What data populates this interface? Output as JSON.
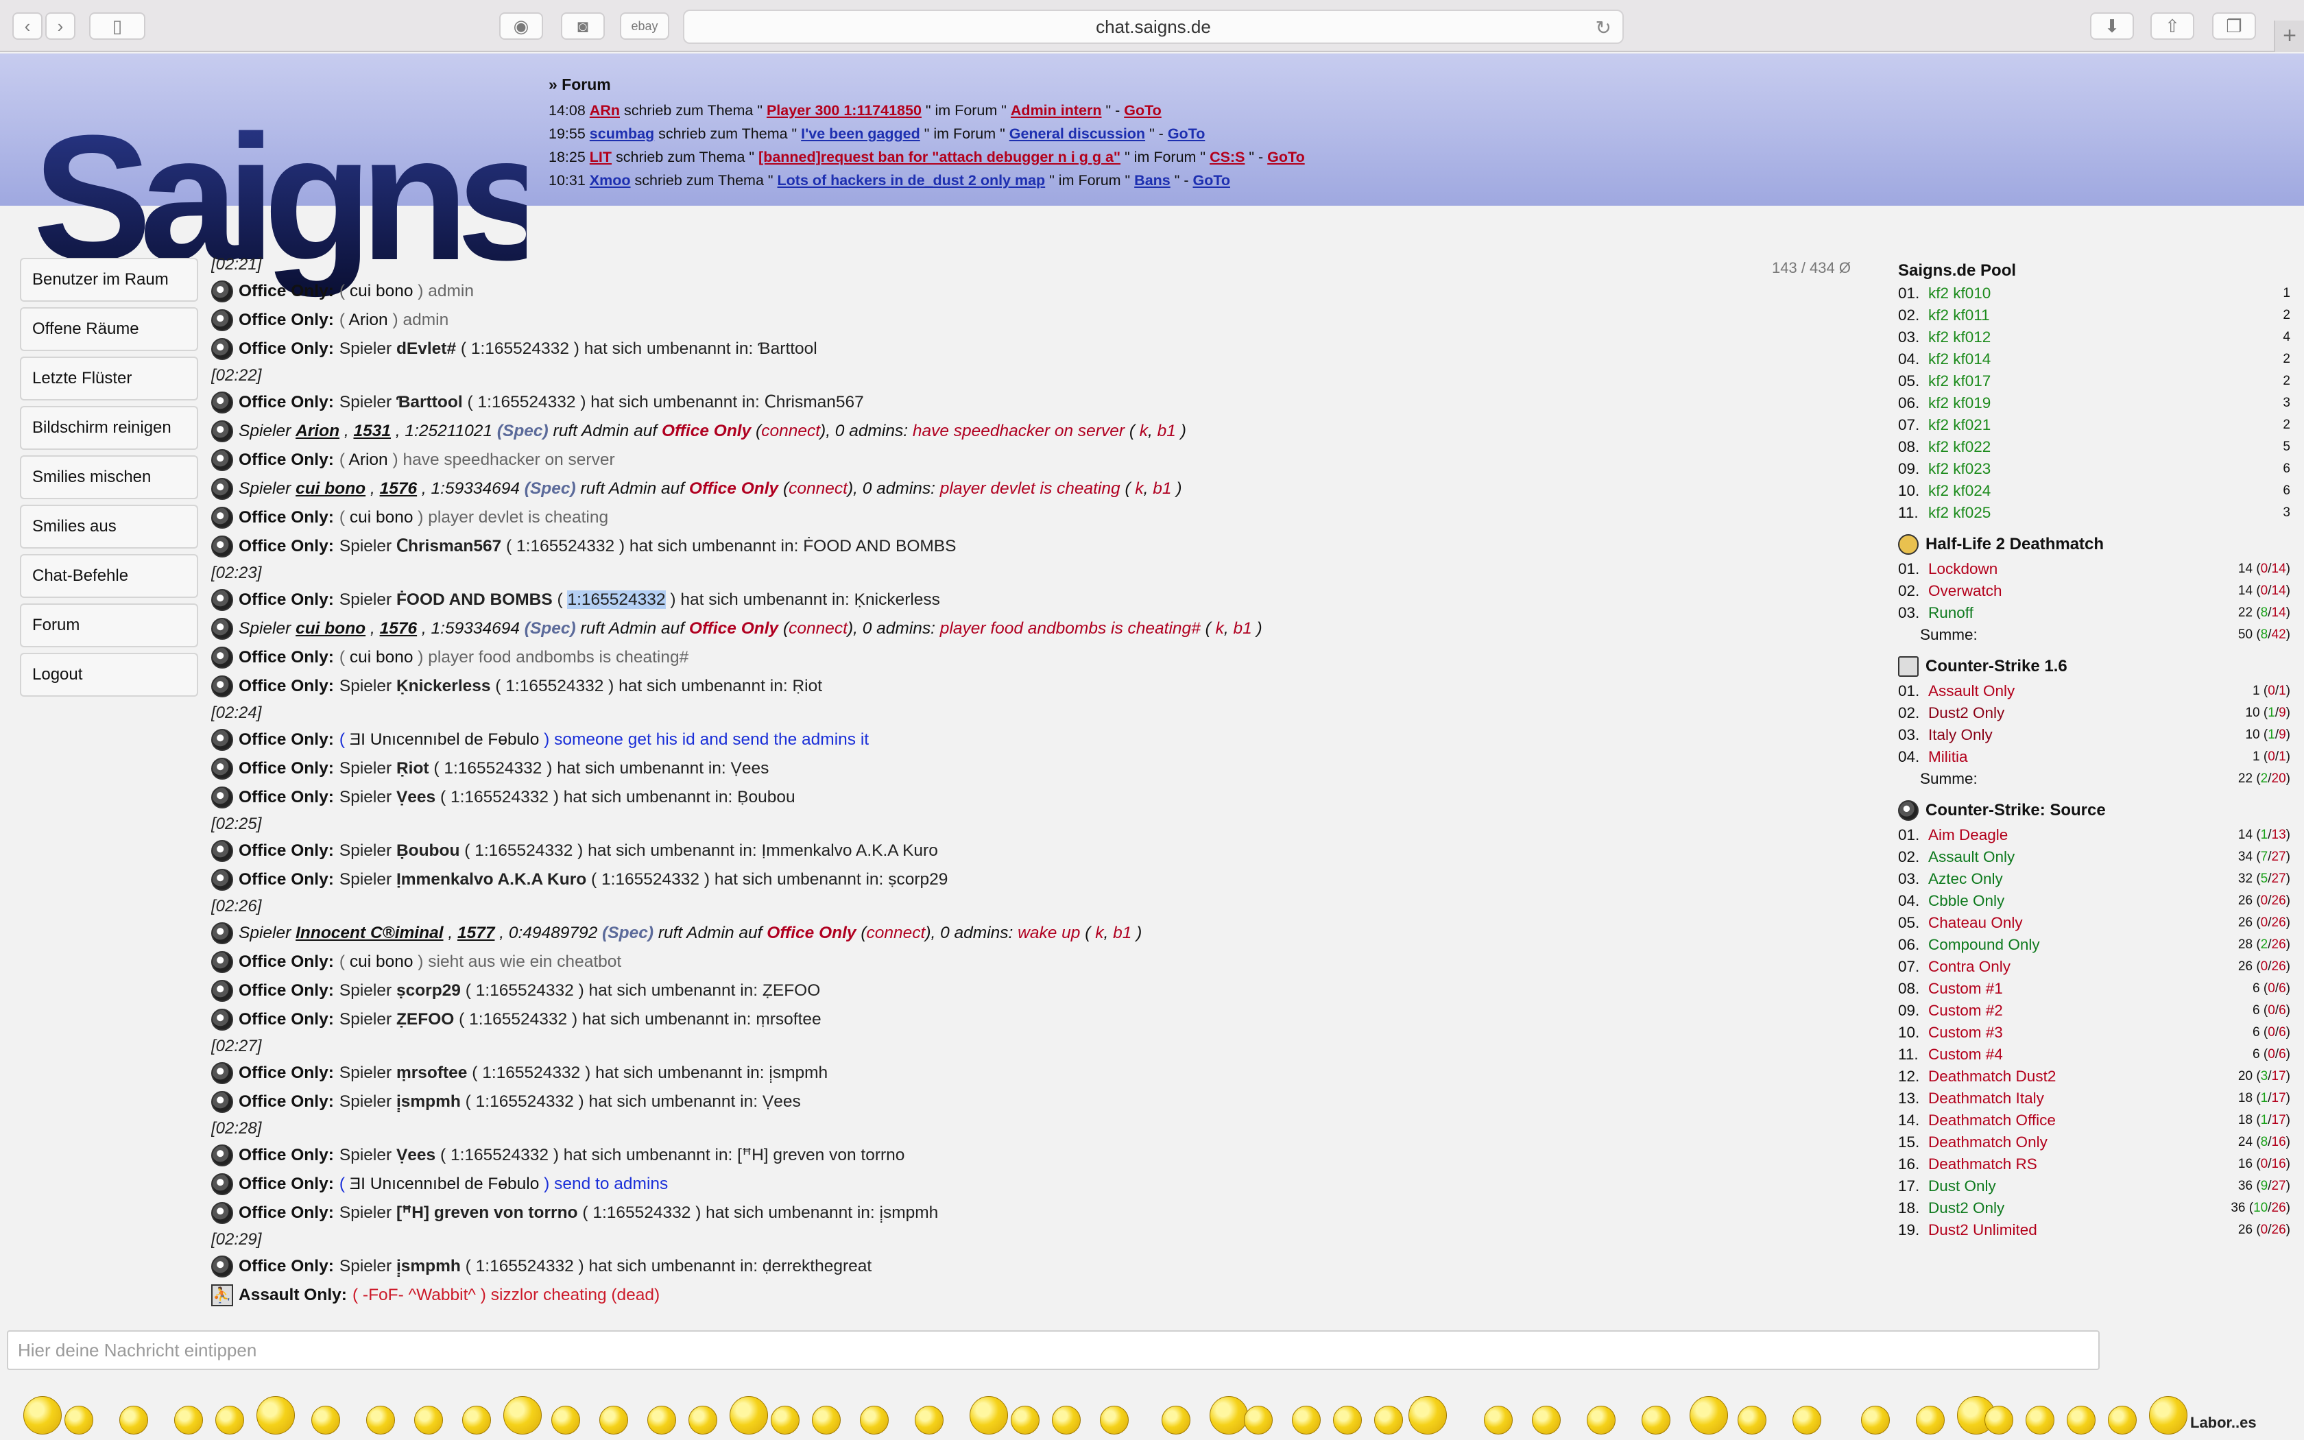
{
  "browser": {
    "url": "chat.saigns.de",
    "bookmark_ebay": "ebay"
  },
  "logo": {
    "text": "Saigns"
  },
  "news": {
    "title": "» Forum",
    "entries": [
      {
        "time": "14:08",
        "user": "ARn",
        "mid": "schrieb zum Thema \"",
        "topic": "Player 300 1:11741850",
        "mid2": "\" im Forum \"",
        "forum": "Admin intern",
        "end": "\" -",
        "goto": "GoTo",
        "color": "red"
      },
      {
        "time": "19:55",
        "user": "scumbag",
        "mid": "schrieb zum Thema \"",
        "topic": "I've been gagged",
        "mid2": "\" im Forum \"",
        "forum": "General discussion",
        "end": "\" -",
        "goto": "GoTo",
        "color": "blue"
      },
      {
        "time": "18:25",
        "user": "LIT",
        "mid": "schrieb zum Thema \"",
        "topic": "[banned]request ban for \"attach debugger n i g g a\"",
        "mid2": "\" im Forum \"",
        "forum": "CS:S",
        "end": "\" -",
        "goto": "GoTo",
        "color": "red"
      },
      {
        "time": "10:31",
        "user": "Xmoo",
        "mid": "schrieb zum Thema \"",
        "topic": "Lots of hackers in de_dust 2 only map",
        "mid2": "\" im Forum \"",
        "forum": "Bans",
        "end": "\" -",
        "goto": "GoTo",
        "color": "blue"
      }
    ]
  },
  "nav": [
    "Benutzer im Raum",
    "Offene Räume",
    "Letzte Flüster",
    "Bildschirm reinigen",
    "Smilies mischen",
    "Smilies aus",
    "Chat-Befehle",
    "Forum",
    "Logout"
  ],
  "counter": "143 / 434 Ø",
  "chat": {
    "room": "Office Only:",
    "spieler": "Spieler",
    "renamed": "hat sich umbenannt in:",
    "id": "1:165524332",
    "lines": [
      {
        "k": "time",
        "t": "[02:21]"
      },
      {
        "k": "say",
        "user": "cui bono",
        "text": "admin",
        "cls": "gray"
      },
      {
        "k": "say",
        "user": "Arion",
        "text": "admin",
        "cls": "gray"
      },
      {
        "k": "ren",
        "from": "dEvlet#",
        "to": "Ɓarttool"
      },
      {
        "k": "time",
        "t": "[02:22]"
      },
      {
        "k": "ren",
        "from": "Ɓarttool",
        "to": "Ⅽhrisman567"
      },
      {
        "k": "adm",
        "user": "Arion",
        "n": "1531",
        "sid": "1:25211021",
        "reason": "have speedhacker on server"
      },
      {
        "k": "say",
        "user": "Arion",
        "text": "have speedhacker on server",
        "cls": "gray"
      },
      {
        "k": "adm",
        "user": "cui bono",
        "n": "1576",
        "sid": "1:59334694",
        "reason": "player devlet is cheating"
      },
      {
        "k": "say",
        "user": "cui bono",
        "text": "player devlet is cheating",
        "cls": "gray"
      },
      {
        "k": "ren",
        "from": "Ⅽhrisman567",
        "to": "ḞOOD AND BOMBS"
      },
      {
        "k": "time",
        "t": "[02:23]"
      },
      {
        "k": "ren",
        "from": "ḞOOD AND BOMBS",
        "to": "Ḳnickerless",
        "hl": true
      },
      {
        "k": "adm",
        "user": "cui bono",
        "n": "1576",
        "sid": "1:59334694",
        "reason": "player food andbombs is cheating#"
      },
      {
        "k": "say",
        "user": "cui bono",
        "text": "player food andbombs is cheating#",
        "cls": "gray"
      },
      {
        "k": "ren",
        "from": "Ḳnickerless",
        "to": "Ṛiot"
      },
      {
        "k": "time",
        "t": "[02:24]"
      },
      {
        "k": "say",
        "user": "ƎI Unıcennıbel de Fɵbulo",
        "text": "someone get his id and send the admins it",
        "cls": "blue"
      },
      {
        "k": "ren",
        "from": "Ṛiot",
        "to": "Ṿees"
      },
      {
        "k": "ren",
        "from": "Ṿees",
        "to": "Ḅoubou"
      },
      {
        "k": "time",
        "t": "[02:25]"
      },
      {
        "k": "ren",
        "from": "Ḅoubou",
        "to": "Ịmmenkalvo A.K.A Kuro"
      },
      {
        "k": "ren",
        "from": "Ịmmenkalvo A.K.A Kuro",
        "to": "ṣcorp29"
      },
      {
        "k": "time",
        "t": "[02:26]"
      },
      {
        "k": "adm",
        "user": "Innocent C®iminal",
        "n": "1577",
        "sid": "0:49489792",
        "reason": "wake up"
      },
      {
        "k": "say",
        "user": "cui bono",
        "text": "sieht aus wie ein cheatbot",
        "cls": "gray"
      },
      {
        "k": "ren",
        "from": "ṣcorp29",
        "to": "ẒEFOO"
      },
      {
        "k": "ren",
        "from": "ẒEFOO",
        "to": "ṃrsoftee"
      },
      {
        "k": "time",
        "t": "[02:27]"
      },
      {
        "k": "ren",
        "from": "ṃrsoftee",
        "to": "ị̣smpmh"
      },
      {
        "k": "ren",
        "from": "ị̣smpmh",
        "to": "Ṿees"
      },
      {
        "k": "time",
        "t": "[02:28]"
      },
      {
        "k": "ren",
        "from": "Ṿees",
        "to": "[ꟸH] greven von torrno"
      },
      {
        "k": "say",
        "user": "ƎI Unıcennıbel de Fɵbulo",
        "text": "send to admins",
        "cls": "blue"
      },
      {
        "k": "ren",
        "from": "[ꟸH] greven von torrno",
        "to": "ị̣smpmh"
      },
      {
        "k": "time",
        "t": "[02:29]"
      },
      {
        "k": "ren",
        "from": "ị̣smpmh",
        "to": "ḍerrekthegreat"
      },
      {
        "k": "assault",
        "room": "Assault Only:",
        "user": "-FoF- ^Wabbit^",
        "text": "sizzlor cheating (dead)"
      }
    ],
    "admin_call": {
      "spieler": "Spieler",
      "spec": "(Spec)",
      "ruft": "ruft Admin auf",
      "room": "Office Only",
      "connect": "connect",
      "admins": ", 0 admins:",
      "k": "k",
      "b1": "b1"
    }
  },
  "pool": {
    "title": "Saigns.de Pool",
    "items": [
      {
        "num": "01.",
        "name": "kf2 kf010",
        "cnt": "1"
      },
      {
        "num": "02.",
        "name": "kf2 kf011",
        "cnt": "2"
      },
      {
        "num": "03.",
        "name": "kf2 kf012",
        "cnt": "4"
      },
      {
        "num": "04.",
        "name": "kf2 kf014",
        "cnt": "2"
      },
      {
        "num": "05.",
        "name": "kf2 kf017",
        "cnt": "2"
      },
      {
        "num": "06.",
        "name": "kf2 kf019",
        "cnt": "3"
      },
      {
        "num": "07.",
        "name": "kf2 kf021",
        "cnt": "2"
      },
      {
        "num": "08.",
        "name": "kf2 kf022",
        "cnt": "5"
      },
      {
        "num": "09.",
        "name": "kf2 kf023",
        "cnt": "6"
      },
      {
        "num": "10.",
        "name": "kf2 kf024",
        "cnt": "6"
      },
      {
        "num": "11.",
        "name": "kf2 kf025",
        "cnt": "3"
      }
    ]
  },
  "servers": [
    {
      "title": "Half-Life 2 Deathmatch",
      "icon": "half-life-icon",
      "items": [
        {
          "num": "01.",
          "name": "Lockdown",
          "total": "14",
          "a": "0",
          "b": "14",
          "color": "red"
        },
        {
          "num": "02.",
          "name": "Overwatch",
          "total": "14",
          "a": "0",
          "b": "14",
          "color": "red"
        },
        {
          "num": "03.",
          "name": "Runoff",
          "total": "22",
          "a": "8",
          "b": "14",
          "color": "green"
        }
      ],
      "sum_label": "Summe:",
      "sum": {
        "total": "50",
        "a": "8",
        "b": "42"
      }
    },
    {
      "title": "Counter-Strike 1.6",
      "icon": "counter-strike-icon",
      "items": [
        {
          "num": "01.",
          "name": "Assault Only",
          "total": "1",
          "a": "0",
          "b": "1",
          "color": "red"
        },
        {
          "num": "02.",
          "name": "Dust2 Only",
          "total": "10",
          "a": "1",
          "b": "9",
          "color": "dark"
        },
        {
          "num": "03.",
          "name": "Italy Only",
          "total": "10",
          "a": "1",
          "b": "9",
          "color": "dark"
        },
        {
          "num": "04.",
          "name": "Militia",
          "total": "1",
          "a": "0",
          "b": "1",
          "color": "red"
        }
      ],
      "sum_label": "Summe:",
      "sum": {
        "total": "22",
        "a": "2",
        "b": "20"
      }
    },
    {
      "title": "Counter-Strike: Source",
      "icon": "counter-strike-source-icon",
      "items": [
        {
          "num": "01.",
          "name": "Aim Deagle",
          "total": "14",
          "a": "1",
          "b": "13",
          "color": "red"
        },
        {
          "num": "02.",
          "name": "Assault Only",
          "total": "34",
          "a": "7",
          "b": "27",
          "color": "green"
        },
        {
          "num": "03.",
          "name": "Aztec Only",
          "total": "32",
          "a": "5",
          "b": "27",
          "color": "green"
        },
        {
          "num": "04.",
          "name": "Cbble Only",
          "total": "26",
          "a": "0",
          "b": "26",
          "color": "green"
        },
        {
          "num": "05.",
          "name": "Chateau Only",
          "total": "26",
          "a": "0",
          "b": "26",
          "color": "red"
        },
        {
          "num": "06.",
          "name": "Compound Only",
          "total": "28",
          "a": "2",
          "b": "26",
          "color": "green"
        },
        {
          "num": "07.",
          "name": "Contra Only",
          "total": "26",
          "a": "0",
          "b": "26",
          "color": "red"
        },
        {
          "num": "08.",
          "name": "Custom #1",
          "total": "6",
          "a": "0",
          "b": "6",
          "color": "red"
        },
        {
          "num": "09.",
          "name": "Custom #2",
          "total": "6",
          "a": "0",
          "b": "6",
          "color": "red"
        },
        {
          "num": "10.",
          "name": "Custom #3",
          "total": "6",
          "a": "0",
          "b": "6",
          "color": "red"
        },
        {
          "num": "11.",
          "name": "Custom #4",
          "total": "6",
          "a": "0",
          "b": "6",
          "color": "red"
        },
        {
          "num": "12.",
          "name": "Deathmatch Dust2",
          "total": "20",
          "a": "3",
          "b": "17",
          "color": "red"
        },
        {
          "num": "13.",
          "name": "Deathmatch Italy",
          "total": "18",
          "a": "1",
          "b": "17",
          "color": "red"
        },
        {
          "num": "14.",
          "name": "Deathmatch Office",
          "total": "18",
          "a": "1",
          "b": "17",
          "color": "red"
        },
        {
          "num": "15.",
          "name": "Deathmatch Only",
          "total": "24",
          "a": "8",
          "b": "16",
          "color": "red"
        },
        {
          "num": "16.",
          "name": "Deathmatch RS",
          "total": "16",
          "a": "0",
          "b": "16",
          "color": "red"
        },
        {
          "num": "17.",
          "name": "Dust Only",
          "total": "36",
          "a": "9",
          "b": "27",
          "color": "green"
        },
        {
          "num": "18.",
          "name": "Dust2 Only",
          "total": "36",
          "a": "10",
          "b": "26",
          "color": "green"
        },
        {
          "num": "19.",
          "name": "Dust2 Unlimited",
          "total": "26",
          "a": "0",
          "b": "26",
          "color": "red"
        }
      ]
    }
  ],
  "input": {
    "placeholder": "Hier deine Nachricht eintippen"
  },
  "smilies_caption": "Labor..es",
  "colors": {
    "header": "#b4bbe8",
    "red": "#b3001b",
    "blue": "#1d2fb0",
    "green": "#1a8a1a"
  }
}
